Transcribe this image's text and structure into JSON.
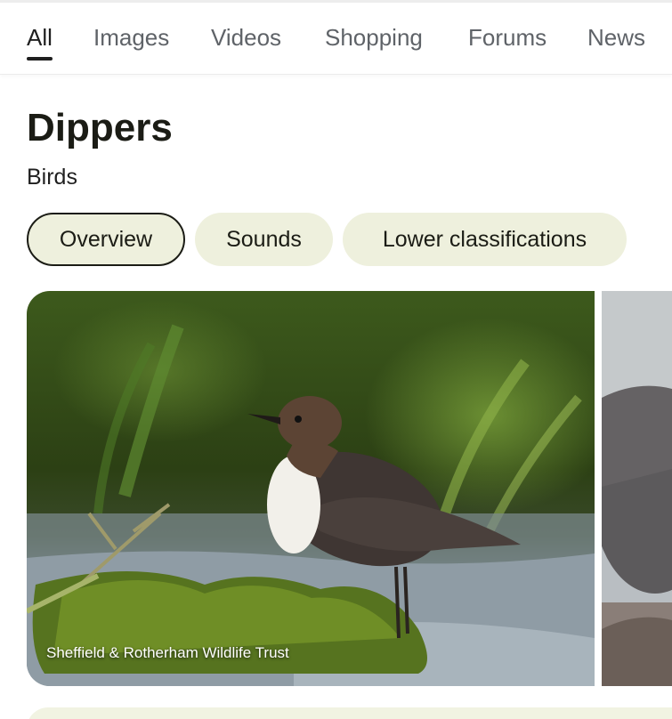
{
  "tabs": [
    {
      "label": "All",
      "active": true
    },
    {
      "label": "Images"
    },
    {
      "label": "Videos"
    },
    {
      "label": "Shopping"
    },
    {
      "label": "Forums"
    },
    {
      "label": "News"
    }
  ],
  "entity": {
    "title": "Dippers",
    "subtitle": "Birds"
  },
  "chips": [
    {
      "label": "Overview",
      "active": true
    },
    {
      "label": "Sounds"
    },
    {
      "label": "Lower classifications"
    }
  ],
  "gallery": {
    "main_image": {
      "subject": "White-throated dipper standing on mossy rock in stream",
      "credit": "Sheffield & Rotherham Wildlife Trust"
    },
    "side_image": {
      "subject": "Dipper (partially visible)"
    }
  },
  "colors": {
    "chip_bg": "#eef0dd",
    "text": "#1f1f1f",
    "tab_inactive": "#5f6368"
  }
}
